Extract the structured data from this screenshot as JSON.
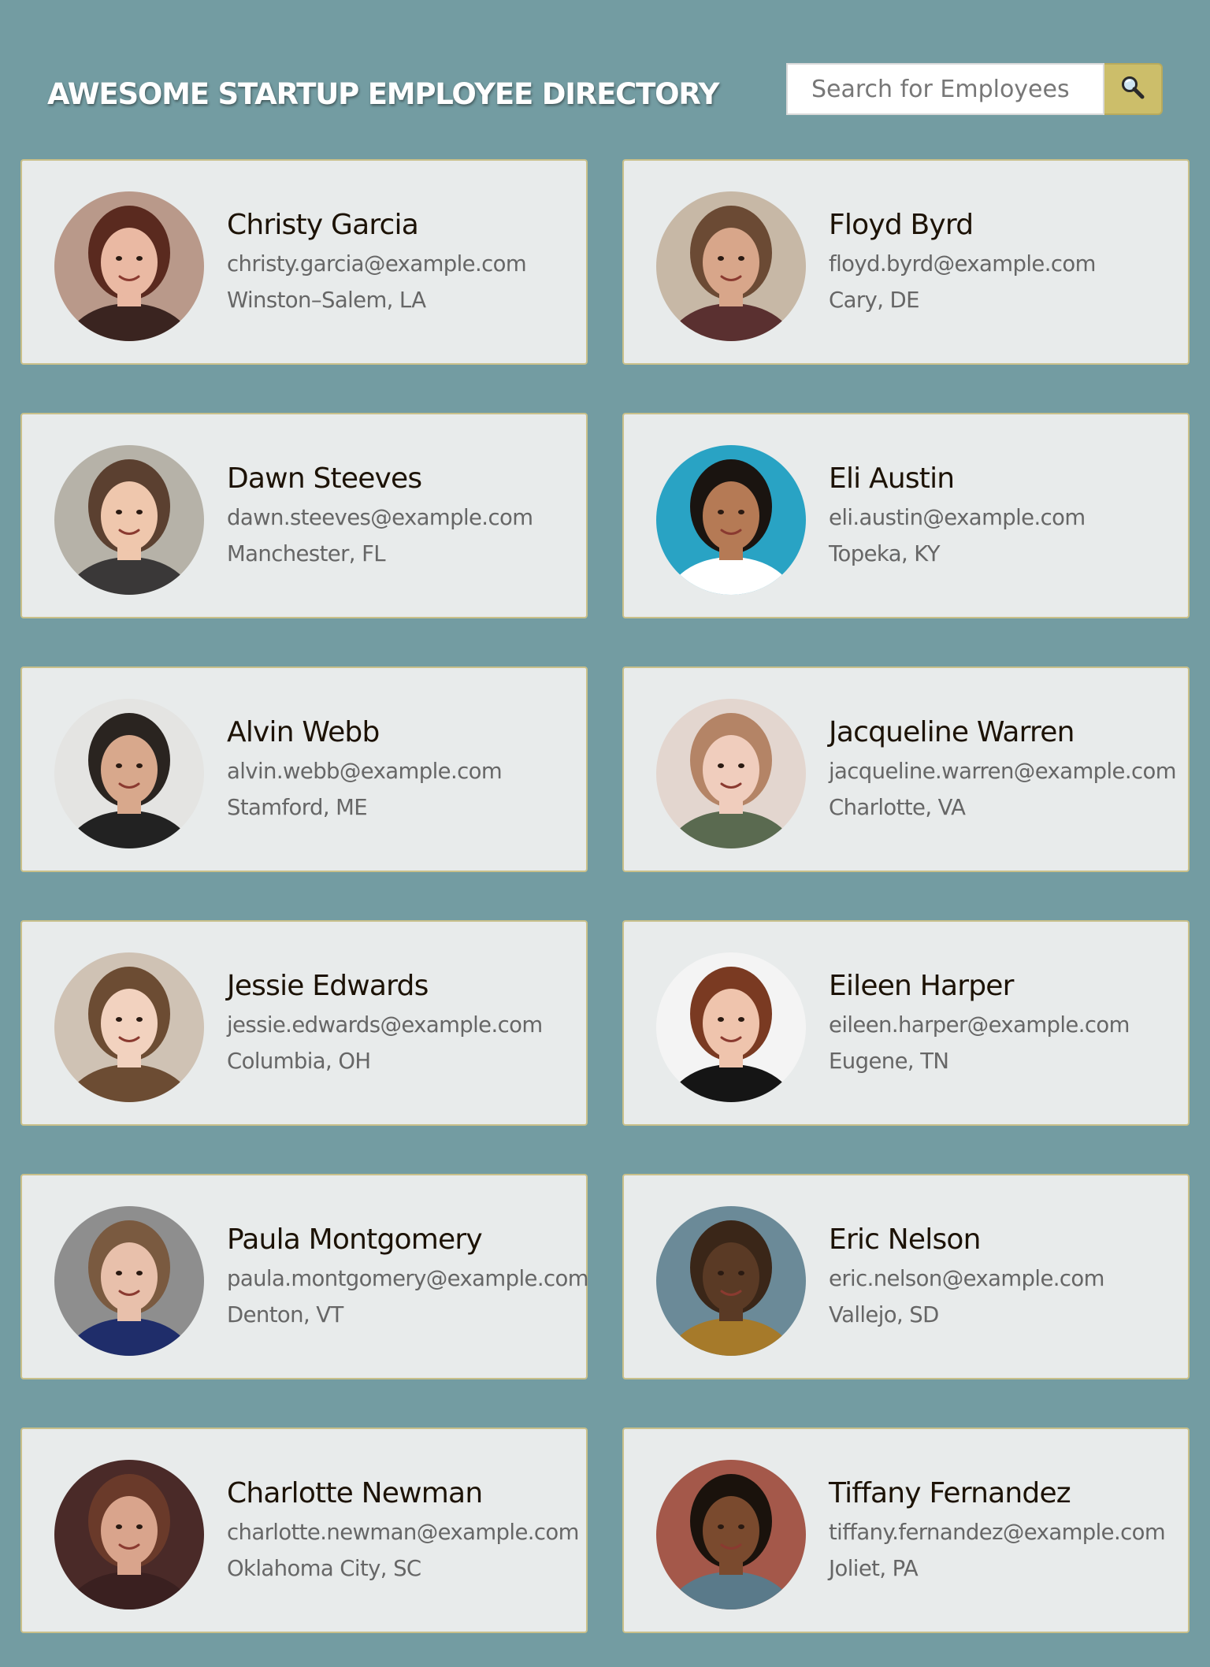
{
  "header": {
    "title": "AWESOME STARTUP EMPLOYEE DIRECTORY",
    "search_placeholder": "Search for Employees",
    "search_icon": "magnifier-icon",
    "search_button_color": "#ccbe6a"
  },
  "theme": {
    "background": "#739ca2",
    "card_background": "#e8ebeb",
    "card_border": "#c9c08a"
  },
  "employees": [
    {
      "name": "Christy Garcia",
      "email": "christy.garcia@example.com",
      "location": "Winston–Salem, LA",
      "photo": {
        "bg": "#b9998a",
        "skin": "#eab9a3",
        "hair": "#5a2a1f",
        "shirt": "#3a2420"
      }
    },
    {
      "name": "Floyd Byrd",
      "email": "floyd.byrd@example.com",
      "location": "Cary, DE",
      "photo": {
        "bg": "#c7b8a6",
        "skin": "#d8a68a",
        "hair": "#6b4a34",
        "shirt": "#5a3030"
      }
    },
    {
      "name": "Dawn Steeves",
      "email": "dawn.steeves@example.com",
      "location": "Manchester, FL",
      "photo": {
        "bg": "#b6b2a8",
        "skin": "#efc7ad",
        "hair": "#5b4030",
        "shirt": "#3a3838"
      }
    },
    {
      "name": "Eli Austin",
      "email": "eli.austin@example.com",
      "location": "Topeka, KY",
      "photo": {
        "bg": "#29a3c4",
        "skin": "#b57a55",
        "hair": "#1a1410",
        "shirt": "#ffffff"
      }
    },
    {
      "name": "Alvin Webb",
      "email": "alvin.webb@example.com",
      "location": "Stamford, ME",
      "photo": {
        "bg": "#e4e4e2",
        "skin": "#d8a88c",
        "hair": "#2a2420",
        "shirt": "#222222"
      }
    },
    {
      "name": "Jacqueline Warren",
      "email": "jacqueline.warren@example.com",
      "location": "Charlotte, VA",
      "photo": {
        "bg": "#e3d6cf",
        "skin": "#f0cdbd",
        "hair": "#b48466",
        "shirt": "#5a6a50"
      }
    },
    {
      "name": "Jessie Edwards",
      "email": "jessie.edwards@example.com",
      "location": "Columbia, OH",
      "photo": {
        "bg": "#cfc2b4",
        "skin": "#f2d2bf",
        "hair": "#6c4c33",
        "shirt": "#6c4c33"
      }
    },
    {
      "name": "Eileen Harper",
      "email": "eileen.harper@example.com",
      "location": "Eugene, TN",
      "photo": {
        "bg": "#f4f4f4",
        "skin": "#efc4ad",
        "hair": "#7a3a22",
        "shirt": "#151515"
      }
    },
    {
      "name": "Paula Montgomery",
      "email": "paula.montgomery@example.com",
      "location": "Denton, VT",
      "photo": {
        "bg": "#8e8e8e",
        "skin": "#e8c0ab",
        "hair": "#7a5a40",
        "shirt": "#1f2d6a"
      }
    },
    {
      "name": "Eric Nelson",
      "email": "eric.nelson@example.com",
      "location": "Vallejo, SD",
      "photo": {
        "bg": "#6b8a98",
        "skin": "#5a3a25",
        "hair": "#3a2618",
        "shirt": "#a67a2a"
      }
    },
    {
      "name": "Charlotte Newman",
      "email": "charlotte.newman@example.com",
      "location": "Oklahoma City, SC",
      "photo": {
        "bg": "#4a2a28",
        "skin": "#d9a48c",
        "hair": "#6a3a2a",
        "shirt": "#3a2020"
      }
    },
    {
      "name": "Tiffany Fernandez",
      "email": "tiffany.fernandez@example.com",
      "location": "Joliet, PA",
      "photo": {
        "bg": "#a4584a",
        "skin": "#7a4a2e",
        "hair": "#1a120c",
        "shirt": "#5a7a8a"
      }
    }
  ]
}
